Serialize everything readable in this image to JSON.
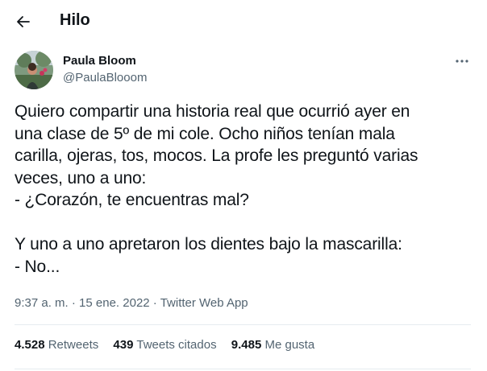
{
  "header": {
    "back_icon": "arrow-left-icon",
    "title": "Hilo"
  },
  "author": {
    "name": "Paula Bloom",
    "handle": "@PaulaBlooom",
    "more_icon": "more-horizontal-icon"
  },
  "tweet": {
    "text": "Quiero compartir una historia real que ocurrió ayer en\nuna clase de 5º de mi cole. Ocho niños tenían mala\ncarilla, ojeras, tos, mocos. La profe les preguntó varias\nveces, uno a uno:\n- ¿Corazón, te encuentras mal?\n\nY uno a uno apretaron los dientes bajo la mascarilla:\n- No..."
  },
  "meta": {
    "time": "9:37 a. m.",
    "date": "15 ene. 2022",
    "source": "Twitter Web App"
  },
  "stats": {
    "retweets_count": "4.528",
    "retweets_label": "Retweets",
    "quotes_count": "439",
    "quotes_label": "Tweets citados",
    "likes_count": "9.485",
    "likes_label": "Me gusta"
  },
  "colors": {
    "text": "#0f1419",
    "secondary": "#536471",
    "divider": "#e6ecf0"
  }
}
